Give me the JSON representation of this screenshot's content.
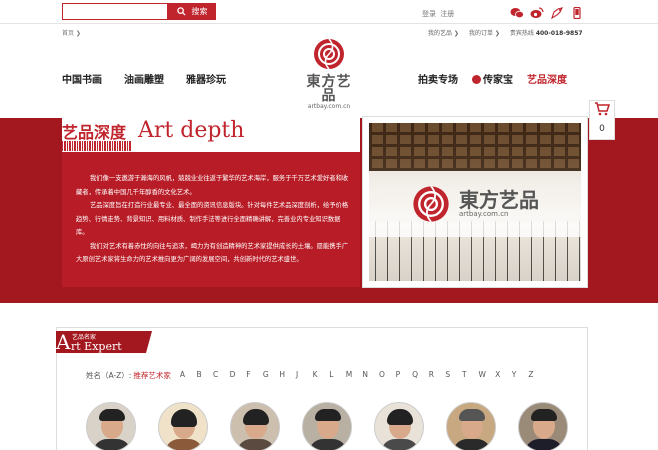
{
  "header": {
    "search_button": "搜索",
    "login": "登录",
    "register": "注册",
    "social_icons": [
      "wechat-icon",
      "weibo-icon",
      "qq-icon",
      "phone-icon"
    ]
  },
  "breadcrumb": {
    "home": "首页 ❯"
  },
  "toplinks": {
    "my_art": "我的艺品 ❯",
    "my_orders": "我的订单 ❯",
    "hotline_label": "贵宾热线",
    "hotline": "400-018-9857"
  },
  "nav": {
    "left": [
      "中国书画",
      "油画雕塑",
      "雅器珍玩"
    ],
    "right": [
      "拍卖专场",
      "传家宝",
      "艺品深度"
    ]
  },
  "logo": {
    "text": "東方艺品",
    "sub": "artbay.com.cn"
  },
  "depth": {
    "title_cn": "艺品深度",
    "title_en": "Art depth",
    "p1": "我们像一支邀游于瀚海的风帆，兢兢业业往返于繁华的艺术海岸，服务于千万艺术爱好者和收藏者，传承着中国几千年醇香的文化艺术。",
    "p2": "艺品深度旨在打造行业最专业、最全面的资讯信息版块。针对每件艺术品深度剖析，给予价格趋势、行情走势、背景知识、用料材质、制作手法等进行全面精确讲解，完善业内专业知识数据库。",
    "p3": "我们对艺术有着赤忱的向往与追求，竭力为有创造精神的艺术家提供成长的土壤。愿能携手广大原创艺术家将生命力的艺术推向更为广阔的发展空间，共创新时代的艺术盛世。"
  },
  "photo_overlay": {
    "text": "東方艺品",
    "sub": "artbay.com.cn"
  },
  "cart": {
    "count": "0"
  },
  "expert": {
    "title_cn": "艺品名家",
    "title_en": "rt Expert",
    "title_big": "A",
    "filter_label": "姓名（A-Z）:",
    "recommend": "推荐艺术家",
    "letters": [
      "A",
      "B",
      "C",
      "D",
      "F",
      "G",
      "H",
      "J",
      "K",
      "L",
      "M",
      "N",
      "O",
      "P",
      "Q",
      "R",
      "S",
      "T",
      "W",
      "X",
      "Y",
      "Z"
    ]
  },
  "colors": {
    "brand_red": "#c0242c",
    "band_red": "#a3171f"
  }
}
